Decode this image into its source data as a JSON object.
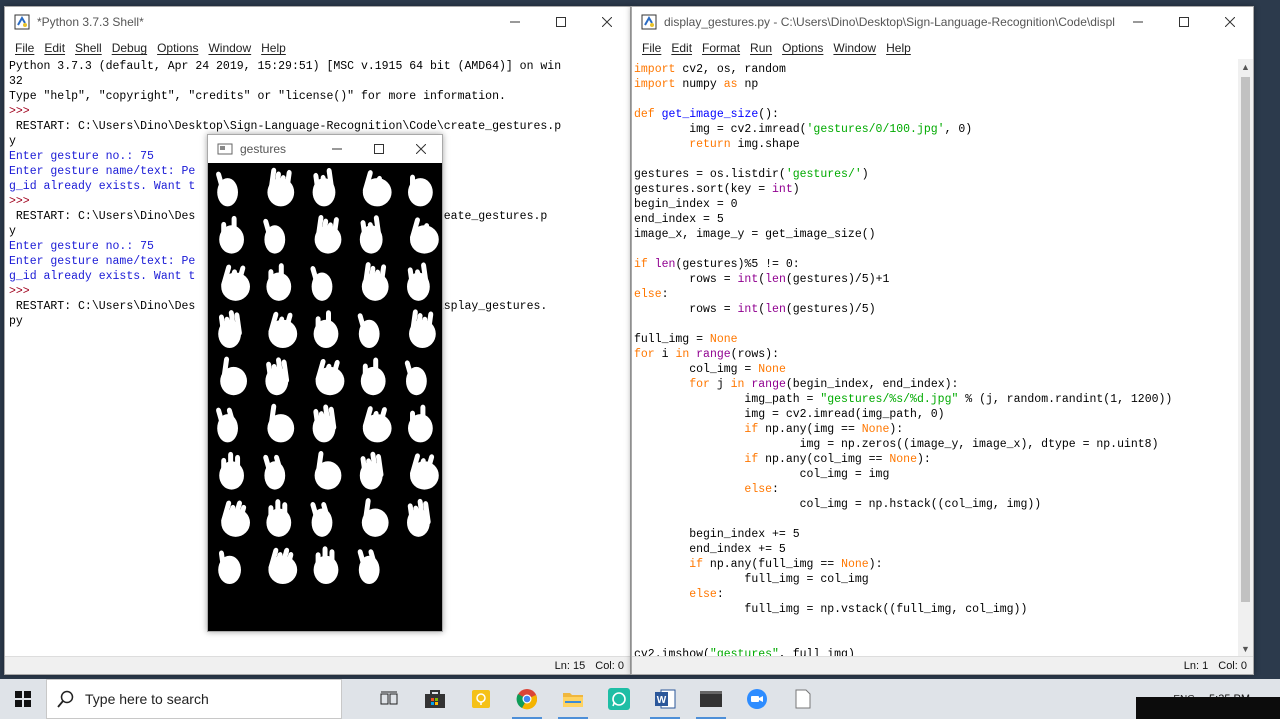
{
  "shell": {
    "title": "*Python 3.7.3 Shell*",
    "menu": [
      "File",
      "Edit",
      "Shell",
      "Debug",
      "Options",
      "Window",
      "Help"
    ],
    "lines": [
      {
        "t": "Python 3.7.3 (default, Apr 24 2019, 15:29:51) [MSC v.1915 64 bit (AMD64)] on win",
        "c": ""
      },
      {
        "t": "32",
        "c": ""
      },
      {
        "t": "Type \"help\", \"copyright\", \"credits\" or \"license()\" for more information.",
        "c": ""
      },
      {
        "t": ">>> ",
        "c": "prm"
      },
      {
        "t": " RESTART: C:\\Users\\Dino\\Desktop\\Sign-Language-Recognition\\Code\\create_gestures.p",
        "c": ""
      },
      {
        "t": "y",
        "c": ""
      },
      {
        "t": "Enter gesture no.: 75",
        "c": "out"
      },
      {
        "t": "Enter gesture name/text: Pe",
        "c": "out"
      },
      {
        "t": "g_id already exists. Want t",
        "c": "out"
      },
      {
        "t": ">>> ",
        "c": "prm"
      },
      {
        "t": " RESTART: C:\\Users\\Dino\\Des                             Code\\create_gestures.p",
        "c": ""
      },
      {
        "t": "y",
        "c": ""
      },
      {
        "t": "Enter gesture no.: 75",
        "c": "out"
      },
      {
        "t": "Enter gesture name/text: Pe",
        "c": "out"
      },
      {
        "t": "g_id already exists. Want t",
        "c": "out"
      },
      {
        "t": ">>> ",
        "c": "prm"
      },
      {
        "t": " RESTART: C:\\Users\\Dino\\Des                             Code\\display_gestures.",
        "c": ""
      },
      {
        "t": "py",
        "c": ""
      }
    ],
    "status_ln": "Ln: 15",
    "status_col": "Col: 0"
  },
  "editor": {
    "title": "display_gestures.py - C:\\Users\\Dino\\Desktop\\Sign-Language-Recognition\\Code\\display_gest...",
    "menu": [
      "File",
      "Edit",
      "Format",
      "Run",
      "Options",
      "Window",
      "Help"
    ],
    "code": [
      "import cv2, os, random",
      "import numpy as np",
      "",
      "def get_image_size():",
      "        img = cv2.imread('gestures/0/100.jpg', 0)",
      "        return img.shape",
      "",
      "gestures = os.listdir('gestures/')",
      "gestures.sort(key = int)",
      "begin_index = 0",
      "end_index = 5",
      "image_x, image_y = get_image_size()",
      "",
      "if len(gestures)%5 != 0:",
      "        rows = int(len(gestures)/5)+1",
      "else:",
      "        rows = int(len(gestures)/5)",
      "",
      "full_img = None",
      "for i in range(rows):",
      "        col_img = None",
      "        for j in range(begin_index, end_index):",
      "                img_path = \"gestures/%s/%d.jpg\" % (j, random.randint(1, 1200))",
      "                img = cv2.imread(img_path, 0)",
      "                if np.any(img == None):",
      "                        img = np.zeros((image_y, image_x), dtype = np.uint8)",
      "                if np.any(col_img == None):",
      "                        col_img = img",
      "                else:",
      "                        col_img = np.hstack((col_img, img))",
      "",
      "        begin_index += 5",
      "        end_index += 5",
      "        if np.any(full_img == None):",
      "                full_img = col_img",
      "        else:",
      "                full_img = np.vstack((full_img, col_img))",
      "",
      "",
      "cv2.imshow(\"gestures\", full_img)"
    ],
    "status_ln": "Ln: 1",
    "status_col": "Col: 0"
  },
  "gestures_window": {
    "title": "gestures",
    "grid_rows": 9,
    "grid_cols": 5,
    "filled_cells": 44
  },
  "taskbar": {
    "search_placeholder": "Type here to search",
    "apps": [
      "task-view",
      "store",
      "sticky-notes",
      "chrome",
      "file-explorer",
      "whatsapp",
      "word",
      "python-idle",
      "zoom",
      "notepad"
    ],
    "tray_label": "ENG",
    "clock": "5:35 PM"
  },
  "colors": {
    "keyword": "#ff7700",
    "builtin": "#900090",
    "string": "#00aa00",
    "defname": "#0000ff",
    "shell_output": "#1a1ad6",
    "prompt": "#a0001c"
  }
}
